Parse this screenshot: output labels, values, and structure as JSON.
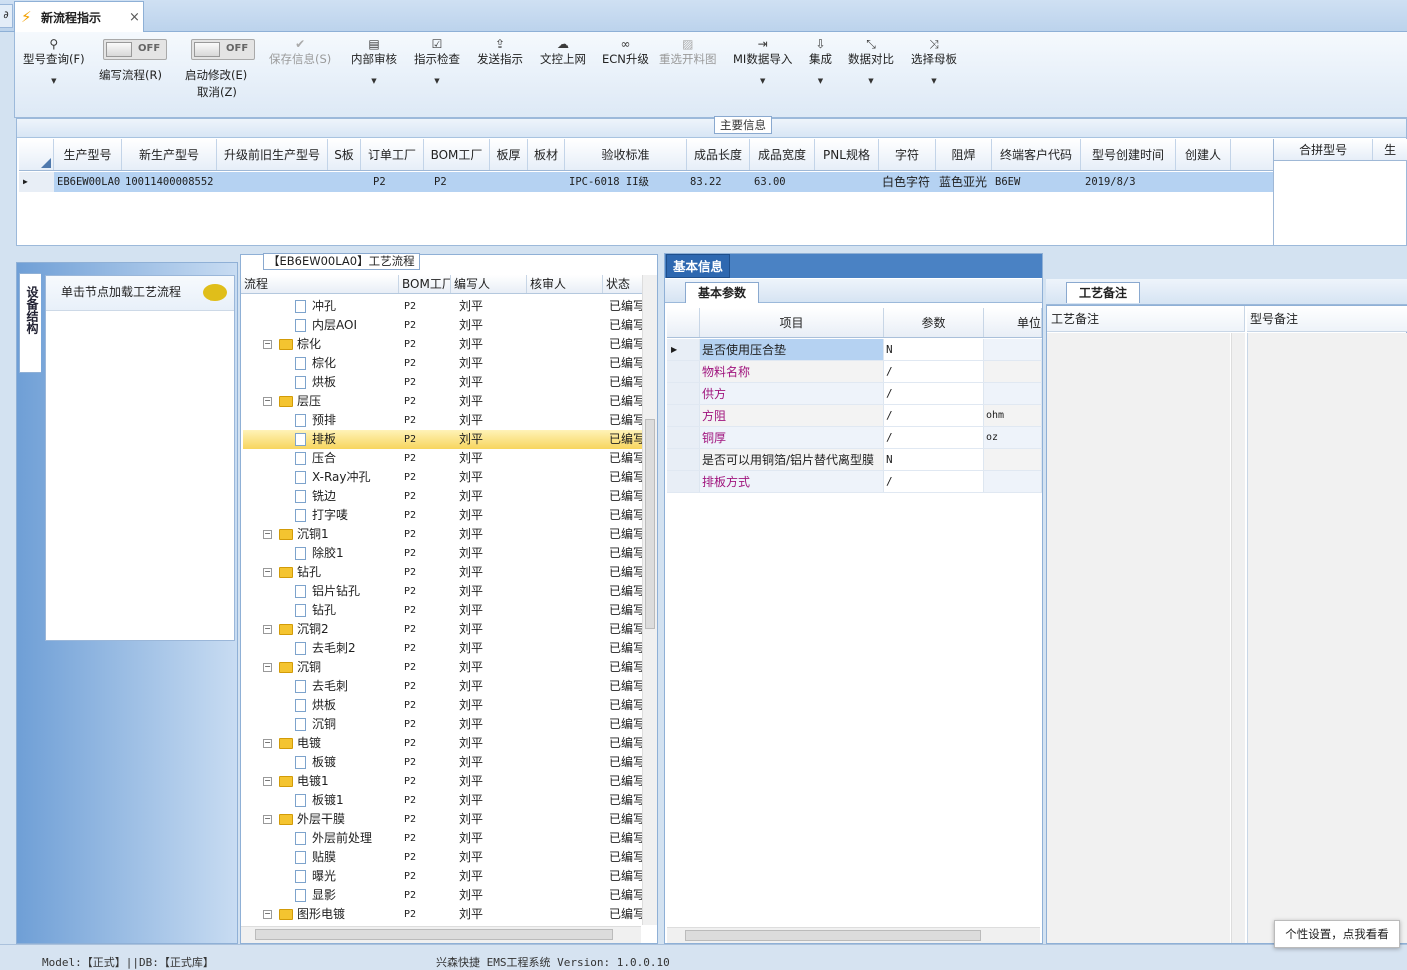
{
  "tab": {
    "title": "新流程指示",
    "close": "×",
    "left_stub": "∂"
  },
  "ribbon": {
    "buttons": [
      {
        "label": "型号查询(F)",
        "icon": "search-icon"
      },
      {
        "label": "保存信息(S)",
        "icon": "check-icon",
        "disabled": true
      },
      {
        "label": "内部审核",
        "icon": "print-icon"
      },
      {
        "label": "指示检查",
        "icon": "checkbox-icon"
      },
      {
        "label": "发送指示",
        "icon": "upload-icon"
      },
      {
        "label": "文控上网",
        "icon": "cloud-icon"
      },
      {
        "label": "ECN升级",
        "icon": "binoculars-icon"
      },
      {
        "label": "重选开料图",
        "icon": "image-icon",
        "disabled": true
      },
      {
        "label": "MI数据导入",
        "icon": "import-icon"
      },
      {
        "label": "集成",
        "icon": "download-icon"
      },
      {
        "label": "数据对比",
        "icon": "compress-icon"
      },
      {
        "label": "选择母板",
        "icon": "shuffle-icon"
      }
    ],
    "toggle1": {
      "state": "OFF",
      "label": "编写流程(R)"
    },
    "toggle2": {
      "state": "OFF",
      "label": "启动修改(E)",
      "label2": "取消(Z)"
    }
  },
  "main_info": {
    "section_label": "主要信息",
    "columns": [
      "生产型号",
      "新生产型号",
      "升级前旧生产型号",
      "S板",
      "订单工厂",
      "BOM工厂",
      "板厚",
      "板材",
      "验收标准",
      "成品长度",
      "成品宽度",
      "PNL规格",
      "字符",
      "阻焊",
      "终端客户代码",
      "型号创建时间",
      "创建人"
    ],
    "row": [
      "EB6EW00LA0",
      "10011400008552",
      "",
      "",
      "P2",
      "P2",
      "",
      "",
      "IPC-6018 II级",
      "83.22",
      "63.00",
      "",
      "白色字符",
      "蓝色亚光",
      "B6EW",
      "2019/8/3",
      ""
    ],
    "side_columns": [
      "合拼型号",
      "生"
    ]
  },
  "left_panel": {
    "vtab": "设备结构",
    "node_hint": "单击节点加载工艺流程"
  },
  "tree": {
    "title": "【EB6EW00LA0】工艺流程",
    "columns": [
      "流程",
      "BOM工厂",
      "编写人",
      "核审人",
      "状态"
    ],
    "rows": [
      {
        "name": "冲孔",
        "level": 1,
        "bom": "P2",
        "writer": "刘平",
        "status": "已编写"
      },
      {
        "name": "内层AOI",
        "level": 1,
        "bom": "P2",
        "writer": "刘平",
        "status": "已编写"
      },
      {
        "name": "棕化",
        "level": 0,
        "bom": "P2",
        "writer": "刘平",
        "status": "已编写"
      },
      {
        "name": "棕化",
        "level": 1,
        "bom": "P2",
        "writer": "刘平",
        "status": "已编写"
      },
      {
        "name": "烘板",
        "level": 1,
        "bom": "P2",
        "writer": "刘平",
        "status": "已编写"
      },
      {
        "name": "层压",
        "level": 0,
        "bom": "P2",
        "writer": "刘平",
        "status": "已编写"
      },
      {
        "name": "预排",
        "level": 1,
        "bom": "P2",
        "writer": "刘平",
        "status": "已编写"
      },
      {
        "name": "排板",
        "level": 1,
        "bom": "P2",
        "writer": "刘平",
        "status": "已编写",
        "selected": true
      },
      {
        "name": "压合",
        "level": 1,
        "bom": "P2",
        "writer": "刘平",
        "status": "已编写"
      },
      {
        "name": "X-Ray冲孔",
        "level": 1,
        "bom": "P2",
        "writer": "刘平",
        "status": "已编写"
      },
      {
        "name": "铣边",
        "level": 1,
        "bom": "P2",
        "writer": "刘平",
        "status": "已编写"
      },
      {
        "name": "打字唛",
        "level": 1,
        "bom": "P2",
        "writer": "刘平",
        "status": "已编写"
      },
      {
        "name": "沉铜1",
        "level": 0,
        "bom": "P2",
        "writer": "刘平",
        "status": "已编写"
      },
      {
        "name": "除胶1",
        "level": 1,
        "bom": "P2",
        "writer": "刘平",
        "status": "已编写"
      },
      {
        "name": "钻孔",
        "level": 0,
        "bom": "P2",
        "writer": "刘平",
        "status": "已编写"
      },
      {
        "name": "铝片钻孔",
        "level": 1,
        "bom": "P2",
        "writer": "刘平",
        "status": "已编写"
      },
      {
        "name": "钻孔",
        "level": 1,
        "bom": "P2",
        "writer": "刘平",
        "status": "已编写"
      },
      {
        "name": "沉铜2",
        "level": 0,
        "bom": "P2",
        "writer": "刘平",
        "status": "已编写"
      },
      {
        "name": "去毛刺2",
        "level": 1,
        "bom": "P2",
        "writer": "刘平",
        "status": "已编写"
      },
      {
        "name": "沉铜",
        "level": 0,
        "bom": "P2",
        "writer": "刘平",
        "status": "已编写"
      },
      {
        "name": "去毛刺",
        "level": 1,
        "bom": "P2",
        "writer": "刘平",
        "status": "已编写"
      },
      {
        "name": "烘板",
        "level": 1,
        "bom": "P2",
        "writer": "刘平",
        "status": "已编写"
      },
      {
        "name": "沉铜",
        "level": 1,
        "bom": "P2",
        "writer": "刘平",
        "status": "已编写"
      },
      {
        "name": "电镀",
        "level": 0,
        "bom": "P2",
        "writer": "刘平",
        "status": "已编写"
      },
      {
        "name": "板镀",
        "level": 1,
        "bom": "P2",
        "writer": "刘平",
        "status": "已编写"
      },
      {
        "name": "电镀1",
        "level": 0,
        "bom": "P2",
        "writer": "刘平",
        "status": "已编写"
      },
      {
        "name": "板镀1",
        "level": 1,
        "bom": "P2",
        "writer": "刘平",
        "status": "已编写"
      },
      {
        "name": "外层干膜",
        "level": 0,
        "bom": "P2",
        "writer": "刘平",
        "status": "已编写"
      },
      {
        "name": "外层前处理",
        "level": 1,
        "bom": "P2",
        "writer": "刘平",
        "status": "已编写"
      },
      {
        "name": "贴膜",
        "level": 1,
        "bom": "P2",
        "writer": "刘平",
        "status": "已编写"
      },
      {
        "name": "曝光",
        "level": 1,
        "bom": "P2",
        "writer": "刘平",
        "status": "已编写"
      },
      {
        "name": "显影",
        "level": 1,
        "bom": "P2",
        "writer": "刘平",
        "status": "已编写"
      },
      {
        "name": "图形电镀",
        "level": 0,
        "bom": "P2",
        "writer": "刘平",
        "status": "已编写"
      }
    ]
  },
  "basic_info": {
    "tab": "基本信息",
    "subtab": "基本参数",
    "columns": [
      "项目",
      "参数",
      "单位"
    ],
    "rows": [
      {
        "item": "是否使用压合垫",
        "param": "N",
        "unit": "",
        "color": "#1e1e1e",
        "current": true
      },
      {
        "item": "物料名称",
        "param": "/",
        "unit": "",
        "color": "#a0147d"
      },
      {
        "item": "供方",
        "param": "/",
        "unit": "",
        "color": "#a0147d"
      },
      {
        "item": "方阻",
        "param": "/",
        "unit": "ohm",
        "color": "#a0147d"
      },
      {
        "item": "铜厚",
        "param": "/",
        "unit": "oz",
        "color": "#a0147d"
      },
      {
        "item": "是否可以用铜箔/铝片替代离型膜",
        "param": "N",
        "unit": "",
        "color": "#1e1e1e"
      },
      {
        "item": "排板方式",
        "param": "/",
        "unit": "",
        "color": "#a0147d"
      }
    ]
  },
  "remarks": {
    "tab": "工艺备注",
    "col1": "工艺备注",
    "col2": "型号备注"
  },
  "status": {
    "model": "Model:【正式】||DB:【正式库】",
    "app": "兴森快捷 EMS工程系统 Version: 1.0.0.10"
  },
  "tooltip": "个性设置，点我看看"
}
